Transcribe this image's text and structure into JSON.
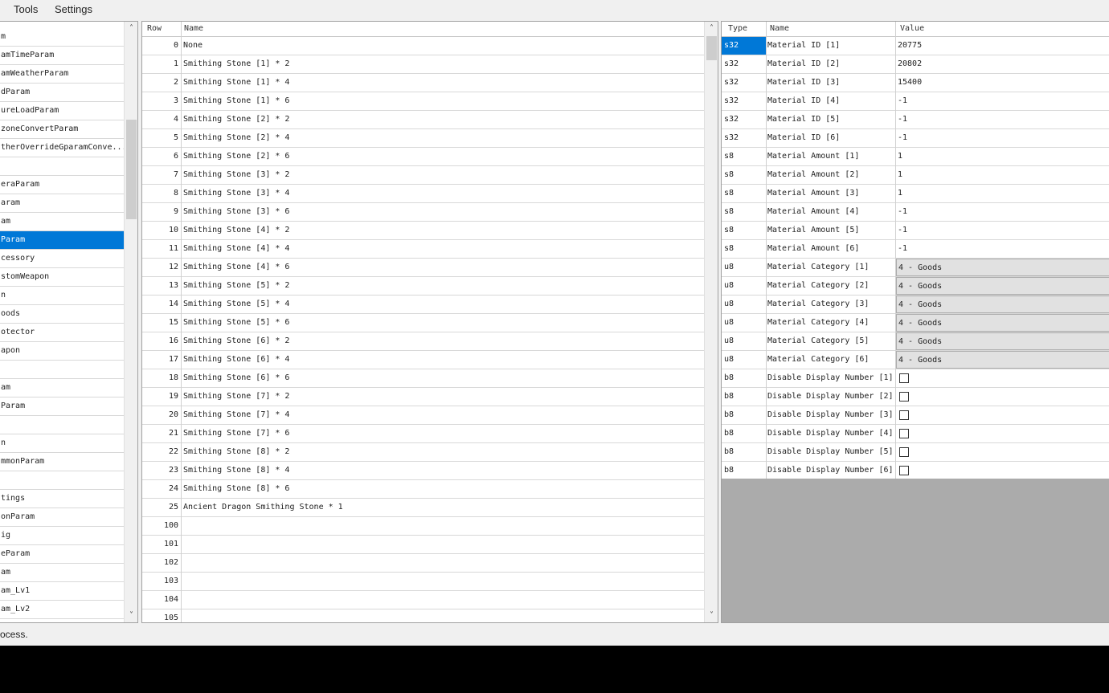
{
  "menu": {
    "tools": "Tools",
    "settings": "Settings"
  },
  "params_list": {
    "items": [
      "m",
      "amTimeParam",
      "amWeatherParam",
      "dParam",
      "ureLoadParam",
      "zoneConvertParam",
      "therOverrideGparamConve...",
      "",
      "eraParam",
      "aram",
      "am",
      "Param",
      "cessory",
      "stomWeapon",
      "n",
      "oods",
      "otector",
      "apon",
      "",
      "am",
      "Param",
      "",
      "n",
      "mmonParam",
      "",
      "tings",
      "onParam",
      "ig",
      "eParam",
      "am",
      "am_Lv1",
      "am_Lv2"
    ],
    "selected_index": 11
  },
  "rows_table": {
    "headers": {
      "row": "Row",
      "name": "Name"
    },
    "rows": [
      {
        "id": "0",
        "name": "None"
      },
      {
        "id": "1",
        "name": "Smithing Stone [1] * 2"
      },
      {
        "id": "2",
        "name": "Smithing Stone [1] * 4"
      },
      {
        "id": "3",
        "name": "Smithing Stone [1] * 6"
      },
      {
        "id": "4",
        "name": "Smithing Stone [2] * 2"
      },
      {
        "id": "5",
        "name": "Smithing Stone [2] * 4"
      },
      {
        "id": "6",
        "name": "Smithing Stone [2] * 6"
      },
      {
        "id": "7",
        "name": "Smithing Stone [3] * 2"
      },
      {
        "id": "8",
        "name": "Smithing Stone [3] * 4"
      },
      {
        "id": "9",
        "name": "Smithing Stone [3] * 6"
      },
      {
        "id": "10",
        "name": "Smithing Stone [4] * 2"
      },
      {
        "id": "11",
        "name": "Smithing Stone [4] * 4"
      },
      {
        "id": "12",
        "name": "Smithing Stone [4] * 6"
      },
      {
        "id": "13",
        "name": "Smithing Stone [5] * 2"
      },
      {
        "id": "14",
        "name": "Smithing Stone [5] * 4"
      },
      {
        "id": "15",
        "name": "Smithing Stone [5] * 6"
      },
      {
        "id": "16",
        "name": "Smithing Stone [6] * 2"
      },
      {
        "id": "17",
        "name": "Smithing Stone [6] * 4"
      },
      {
        "id": "18",
        "name": "Smithing Stone [6] * 6"
      },
      {
        "id": "19",
        "name": "Smithing Stone [7] * 2"
      },
      {
        "id": "20",
        "name": "Smithing Stone [7] * 4"
      },
      {
        "id": "21",
        "name": "Smithing Stone [7] * 6"
      },
      {
        "id": "22",
        "name": "Smithing Stone [8] * 2"
      },
      {
        "id": "23",
        "name": "Smithing Stone [8] * 4"
      },
      {
        "id": "24",
        "name": "Smithing Stone [8] * 6"
      },
      {
        "id": "25",
        "name": "Ancient Dragon Smithing Stone * 1"
      },
      {
        "id": "100",
        "name": ""
      },
      {
        "id": "101",
        "name": ""
      },
      {
        "id": "102",
        "name": ""
      },
      {
        "id": "103",
        "name": ""
      },
      {
        "id": "104",
        "name": ""
      },
      {
        "id": "105",
        "name": ""
      }
    ]
  },
  "fields_table": {
    "headers": {
      "type": "Type",
      "name": "Name",
      "value": "Value"
    },
    "rows": [
      {
        "type": "s32",
        "name": "Material ID [1]",
        "value": "20775",
        "kind": "text"
      },
      {
        "type": "s32",
        "name": "Material ID [2]",
        "value": "20802",
        "kind": "text"
      },
      {
        "type": "s32",
        "name": "Material ID [3]",
        "value": "15400",
        "kind": "text"
      },
      {
        "type": "s32",
        "name": "Material ID [4]",
        "value": "-1",
        "kind": "text"
      },
      {
        "type": "s32",
        "name": "Material ID [5]",
        "value": "-1",
        "kind": "text"
      },
      {
        "type": "s32",
        "name": "Material ID [6]",
        "value": "-1",
        "kind": "text"
      },
      {
        "type": "s8",
        "name": "Material Amount [1]",
        "value": "1",
        "kind": "text"
      },
      {
        "type": "s8",
        "name": "Material Amount [2]",
        "value": "1",
        "kind": "text"
      },
      {
        "type": "s8",
        "name": "Material Amount [3]",
        "value": "1",
        "kind": "text"
      },
      {
        "type": "s8",
        "name": "Material Amount [4]",
        "value": "-1",
        "kind": "text"
      },
      {
        "type": "s8",
        "name": "Material Amount [5]",
        "value": "-1",
        "kind": "text"
      },
      {
        "type": "s8",
        "name": "Material Amount [6]",
        "value": "-1",
        "kind": "text"
      },
      {
        "type": "u8",
        "name": "Material Category [1]",
        "value": "4 - Goods",
        "kind": "combo"
      },
      {
        "type": "u8",
        "name": "Material Category [2]",
        "value": "4 - Goods",
        "kind": "combo"
      },
      {
        "type": "u8",
        "name": "Material Category [3]",
        "value": "4 - Goods",
        "kind": "combo"
      },
      {
        "type": "u8",
        "name": "Material Category [4]",
        "value": "4 - Goods",
        "kind": "combo"
      },
      {
        "type": "u8",
        "name": "Material Category [5]",
        "value": "4 - Goods",
        "kind": "combo"
      },
      {
        "type": "u8",
        "name": "Material Category [6]",
        "value": "4 - Goods",
        "kind": "combo"
      },
      {
        "type": "b8",
        "name": "Disable Display Number [1]",
        "value": "",
        "kind": "checkbox"
      },
      {
        "type": "b8",
        "name": "Disable Display Number [2]",
        "value": "",
        "kind": "checkbox"
      },
      {
        "type": "b8",
        "name": "Disable Display Number [3]",
        "value": "",
        "kind": "checkbox"
      },
      {
        "type": "b8",
        "name": "Disable Display Number [4]",
        "value": "",
        "kind": "checkbox"
      },
      {
        "type": "b8",
        "name": "Disable Display Number [5]",
        "value": "",
        "kind": "checkbox"
      },
      {
        "type": "b8",
        "name": "Disable Display Number [6]",
        "value": "",
        "kind": "checkbox"
      }
    ],
    "selected_type_index": 0
  },
  "status": {
    "text": "ocess."
  },
  "icons": {
    "scroll_up": "chevron-up-icon",
    "scroll_down": "chevron-down-icon"
  },
  "colors": {
    "selection": "#0078d7",
    "empty_area": "#ababab"
  }
}
